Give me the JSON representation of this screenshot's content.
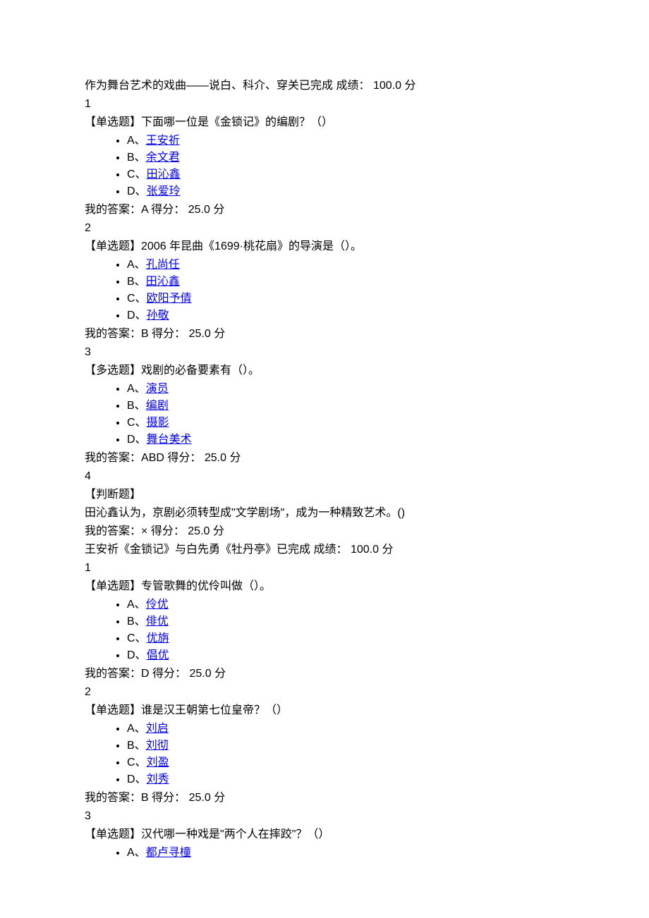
{
  "labels": {
    "completed": "已完成",
    "score_label": "成绩：",
    "score_unit": "分",
    "my_answer": "我的答案：",
    "points_label": "得分：",
    "tag_single": "【单选题】",
    "tag_multi": "【多选题】",
    "tag_judge": "【判断题】"
  },
  "sections": [
    {
      "title": "作为舞台艺术的戏曲——说白、科介、穿关",
      "score": "100.0",
      "questions": [
        {
          "num": "1",
          "tag_key": "tag_single",
          "stem": "下面哪一位是《金锁记》的编剧？（）",
          "options": [
            {
              "letter": "A、",
              "text": "王安祈"
            },
            {
              "letter": "B、",
              "text": "余文君"
            },
            {
              "letter": "C、",
              "text": "田沁鑫"
            },
            {
              "letter": "D、",
              "text": "张爱玲"
            }
          ],
          "answer": "A",
          "points": "25.0"
        },
        {
          "num": "2",
          "tag_key": "tag_single",
          "stem": "2006 年昆曲《1699·桃花扇》的导演是（）。",
          "options": [
            {
              "letter": "A、",
              "text": "孔尚任"
            },
            {
              "letter": "B、",
              "text": "田沁鑫"
            },
            {
              "letter": "C、",
              "text": "欧阳予倩"
            },
            {
              "letter": "D、",
              "text": "孙敬"
            }
          ],
          "answer": "B",
          "points": "25.0"
        },
        {
          "num": "3",
          "tag_key": "tag_multi",
          "stem": "戏剧的必备要素有（）。",
          "options": [
            {
              "letter": "A、",
              "text": "演员"
            },
            {
              "letter": "B、",
              "text": "编剧"
            },
            {
              "letter": "C、",
              "text": "摄影"
            },
            {
              "letter": "D、",
              "text": "舞台美术"
            }
          ],
          "answer": "ABD",
          "points": "25.0"
        },
        {
          "num": "4",
          "tag_key": "tag_judge",
          "stem": "",
          "body": "田沁鑫认为，京剧必须转型成\"文学剧场\"，成为一种精致艺术。()",
          "answer": "×",
          "points": "25.0"
        }
      ]
    },
    {
      "title": "王安祈《金锁记》与白先勇《牡丹亭》",
      "score": "100.0",
      "questions": [
        {
          "num": "1",
          "tag_key": "tag_single",
          "stem": "专管歌舞的优伶叫做（）。",
          "options": [
            {
              "letter": "A、",
              "text": "伶优"
            },
            {
              "letter": "B、",
              "text": "俳优"
            },
            {
              "letter": "C、",
              "text": "优旃"
            },
            {
              "letter": "D、",
              "text": "倡优"
            }
          ],
          "answer": "D",
          "points": "25.0"
        },
        {
          "num": "2",
          "tag_key": "tag_single",
          "stem": "谁是汉王朝第七位皇帝？（）",
          "options": [
            {
              "letter": "A、",
              "text": "刘启"
            },
            {
              "letter": "B、",
              "text": "刘彻"
            },
            {
              "letter": "C、",
              "text": "刘盈"
            },
            {
              "letter": "D、",
              "text": "刘秀"
            }
          ],
          "answer": "B",
          "points": "25.0"
        },
        {
          "num": "3",
          "tag_key": "tag_single",
          "stem": "汉代哪一种戏是\"两个人在摔跤\"？（）",
          "options": [
            {
              "letter": "A、",
              "text": "都卢寻橦"
            }
          ],
          "partial": true
        }
      ]
    }
  ]
}
